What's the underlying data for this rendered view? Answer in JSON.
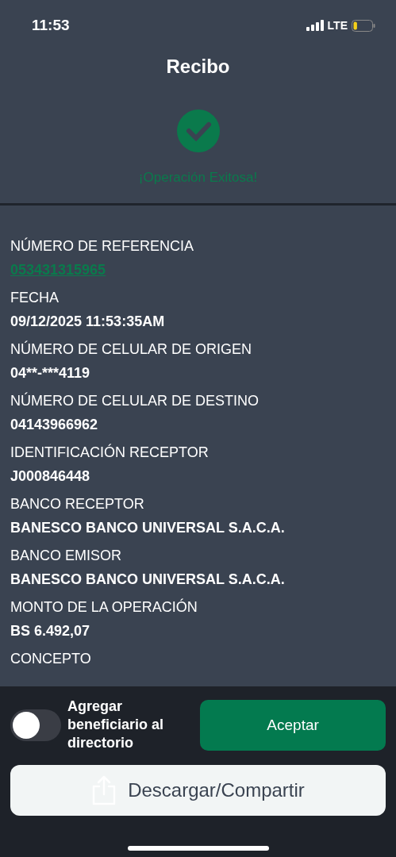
{
  "status_bar": {
    "time": "11:53",
    "network": "LTE"
  },
  "header": {
    "title": "Recibo",
    "status": "¡Operación Exitosa!"
  },
  "fields": [
    {
      "label": "NÚMERO DE REFERENCIA",
      "value": "053431315965",
      "kind": "link"
    },
    {
      "label": "FECHA",
      "value": "09/12/2025 11:53:35AM",
      "kind": "text"
    },
    {
      "label": "NÚMERO DE CELULAR DE ORIGEN",
      "value": "04**-***4119",
      "kind": "text"
    },
    {
      "label": "NÚMERO DE CELULAR DE DESTINO",
      "value": "04143966962",
      "kind": "text"
    },
    {
      "label": "IDENTIFICACIÓN RECEPTOR",
      "value": "J000846448",
      "kind": "text"
    },
    {
      "label": "BANCO RECEPTOR",
      "value": "BANESCO BANCO UNIVERSAL S.A.C.A.",
      "kind": "text"
    },
    {
      "label": "BANCO EMISOR",
      "value": "BANESCO BANCO UNIVERSAL S.A.C.A.",
      "kind": "text"
    },
    {
      "label": "MONTO DE LA OPERACIÓN",
      "value": "BS 6.492,07",
      "kind": "text"
    },
    {
      "label": "CONCEPTO"
    }
  ],
  "footer": {
    "toggle": {
      "label": "Agregar beneficiario al directorio",
      "on": false
    },
    "accept_button": "Aceptar",
    "share_button": "Descargar/Compartir"
  }
}
